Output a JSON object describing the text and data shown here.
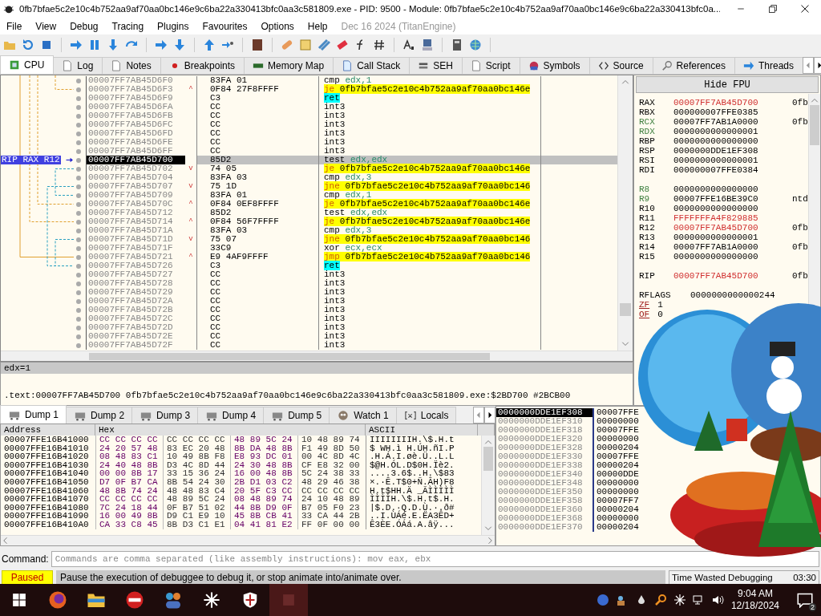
{
  "window": {
    "title": "0fb7bfae5c2e10c4b752aa9af70aa0bc146e9c6ba22a330413bfc0aa3c581809.exe - PID: 9500 - Module: 0fb7bfae5c2e10c4b752aa9af70aa0bc146e9c6ba22a330413bfc0a..."
  },
  "menu": [
    "File",
    "View",
    "Debug",
    "Tracing",
    "Plugins",
    "Favourites",
    "Options",
    "Help"
  ],
  "build_info": "Dec 16 2024 (TitanEngine)",
  "tabs": [
    {
      "label": "CPU",
      "selected": true
    },
    {
      "label": "Log",
      "selected": false
    },
    {
      "label": "Notes",
      "selected": false
    },
    {
      "label": "Breakpoints",
      "selected": false
    },
    {
      "label": "Memory Map",
      "selected": false
    },
    {
      "label": "Call Stack",
      "selected": false
    },
    {
      "label": "SEH",
      "selected": false
    },
    {
      "label": "Script",
      "selected": false
    },
    {
      "label": "Symbols",
      "selected": false
    },
    {
      "label": "Source",
      "selected": false
    },
    {
      "label": "References",
      "selected": false
    },
    {
      "label": "Threads",
      "selected": false
    }
  ],
  "disassembly": {
    "rip_label": "RIP RAX R12",
    "rows": [
      {
        "address": "00007FF7AB45D6F0",
        "bytes": "83FA 01",
        "kind": "plain",
        "mnemonic": "cmp",
        "operands": "edx,1",
        "selected": false
      },
      {
        "address": "00007FF7AB45D6F3",
        "jump": "^",
        "bytes": "0F84 27F8FFFF",
        "kind": "jump",
        "mnemonic": "je",
        "operands": "0fb7bfae5c2e10c4b752aa9af70aa0bc146e",
        "selected": false
      },
      {
        "address": "00007FF7AB45D6F9",
        "bytes": "C3",
        "kind": "ret",
        "mnemonic": "ret",
        "selected": false
      },
      {
        "address": "00007FF7AB45D6FA",
        "bytes": "CC",
        "kind": "plain",
        "mnemonic": "int3",
        "selected": false
      },
      {
        "address": "00007FF7AB45D6FB",
        "bytes": "CC",
        "kind": "plain",
        "mnemonic": "int3",
        "selected": false
      },
      {
        "address": "00007FF7AB45D6FC",
        "bytes": "CC",
        "kind": "plain",
        "mnemonic": "int3",
        "selected": false
      },
      {
        "address": "00007FF7AB45D6FD",
        "bytes": "CC",
        "kind": "plain",
        "mnemonic": "int3",
        "selected": false
      },
      {
        "address": "00007FF7AB45D6FE",
        "bytes": "CC",
        "kind": "plain",
        "mnemonic": "int3",
        "selected": false
      },
      {
        "address": "00007FF7AB45D6FF",
        "bytes": "CC",
        "kind": "plain",
        "mnemonic": "int3",
        "selected": false
      },
      {
        "address": "00007FF7AB45D700",
        "bytes": "85D2",
        "kind": "plain",
        "mnemonic": "test",
        "operands": "edx,edx",
        "selected": true
      },
      {
        "address": "00007FF7AB45D702",
        "jump": "v",
        "bytes": "74 05",
        "kind": "jump",
        "mnemonic": "je",
        "operands": "0fb7bfae5c2e10c4b752aa9af70aa0bc146e",
        "selected": false
      },
      {
        "address": "00007FF7AB45D704",
        "bytes": "83FA 03",
        "kind": "plain",
        "mnemonic": "cmp",
        "operands": "edx,3",
        "selected": false
      },
      {
        "address": "00007FF7AB45D707",
        "jump": "v",
        "bytes": "75 1D",
        "kind": "jump",
        "mnemonic": "jne",
        "operands": "0fb7bfae5c2e10c4b752aa9af70aa0bc146",
        "selected": false
      },
      {
        "address": "00007FF7AB45D709",
        "bytes": "83FA 01",
        "kind": "plain",
        "mnemonic": "cmp",
        "operands": "edx,1",
        "selected": false
      },
      {
        "address": "00007FF7AB45D70C",
        "jump": "^",
        "bytes": "0F84 0EF8FFFF",
        "kind": "jump",
        "mnemonic": "je",
        "operands": "0fb7bfae5c2e10c4b752aa9af70aa0bc146e",
        "selected": false
      },
      {
        "address": "00007FF7AB45D712",
        "bytes": "85D2",
        "kind": "plain",
        "mnemonic": "test",
        "operands": "edx,edx",
        "selected": false
      },
      {
        "address": "00007FF7AB45D714",
        "jump": "^",
        "bytes": "0F84 56F7FFFF",
        "kind": "jump",
        "mnemonic": "je",
        "operands": "0fb7bfae5c2e10c4b752aa9af70aa0bc146e",
        "selected": false
      },
      {
        "address": "00007FF7AB45D71A",
        "bytes": "83FA 03",
        "kind": "plain",
        "mnemonic": "cmp",
        "operands": "edx,3",
        "selected": false
      },
      {
        "address": "00007FF7AB45D71D",
        "jump": "v",
        "bytes": "75 07",
        "kind": "jump",
        "mnemonic": "jne",
        "operands": "0fb7bfae5c2e10c4b752aa9af70aa0bc146",
        "selected": false
      },
      {
        "address": "00007FF7AB45D71F",
        "bytes": "33C9",
        "kind": "plain",
        "mnemonic": "xor",
        "operands": "ecx,ecx",
        "selected": false
      },
      {
        "address": "00007FF7AB45D721",
        "jump": "^",
        "bytes": "E9 4AF9FFFF",
        "kind": "jump",
        "mnemonic": "jmp",
        "operands": "0fb7bfae5c2e10c4b752aa9af70aa0bc146",
        "selected": false
      },
      {
        "address": "00007FF7AB45D726",
        "bytes": "C3",
        "kind": "ret",
        "mnemonic": "ret",
        "selected": false
      },
      {
        "address": "00007FF7AB45D727",
        "bytes": "CC",
        "kind": "plain",
        "mnemonic": "int3",
        "selected": false
      },
      {
        "address": "00007FF7AB45D728",
        "bytes": "CC",
        "kind": "plain",
        "mnemonic": "int3",
        "selected": false
      },
      {
        "address": "00007FF7AB45D729",
        "bytes": "CC",
        "kind": "plain",
        "mnemonic": "int3",
        "selected": false
      },
      {
        "address": "00007FF7AB45D72A",
        "bytes": "CC",
        "kind": "plain",
        "mnemonic": "int3",
        "selected": false
      },
      {
        "address": "00007FF7AB45D72B",
        "bytes": "CC",
        "kind": "plain",
        "mnemonic": "int3",
        "selected": false
      },
      {
        "address": "00007FF7AB45D72C",
        "bytes": "CC",
        "kind": "plain",
        "mnemonic": "int3",
        "selected": false
      },
      {
        "address": "00007FF7AB45D72D",
        "bytes": "CC",
        "kind": "plain",
        "mnemonic": "int3",
        "selected": false
      },
      {
        "address": "00007FF7AB45D72E",
        "bytes": "CC",
        "kind": "plain",
        "mnemonic": "int3",
        "selected": false
      },
      {
        "address": "00007FF7AB45D72F",
        "bytes": "CC",
        "kind": "plain",
        "mnemonic": "int3",
        "selected": false
      }
    ]
  },
  "registers": {
    "button": "Hide FPU",
    "groups": [
      [
        {
          "name": "RAX",
          "value": "00007FF7AB45D700",
          "changed": true,
          "name_changed": false,
          "comment": "0fb"
        },
        {
          "name": "RBX",
          "value": "000000007FFE0385",
          "changed": false,
          "name_changed": false
        },
        {
          "name": "RCX",
          "value": "00007FF7AB1A0000",
          "changed": false,
          "name_changed": true,
          "comment": "0fb"
        },
        {
          "name": "RDX",
          "value": "0000000000000001",
          "changed": false,
          "name_changed": true
        },
        {
          "name": "RBP",
          "value": "0000000000000000",
          "changed": false,
          "name_changed": false
        },
        {
          "name": "RSP",
          "value": "0000000DDE1EF308",
          "changed": false,
          "name_changed": false
        },
        {
          "name": "RSI",
          "value": "0000000000000001",
          "changed": false,
          "name_changed": false
        },
        {
          "name": "RDI",
          "value": "000000007FFE0384",
          "changed": false,
          "name_changed": false
        }
      ],
      [
        {
          "name": "R8",
          "value": "0000000000000000",
          "changed": false,
          "name_changed": true
        },
        {
          "name": "R9",
          "value": "00007FFE16BE39C0",
          "changed": false,
          "name_changed": true,
          "comment": "ntd"
        },
        {
          "name": "R10",
          "value": "0000000000000000",
          "changed": false,
          "name_changed": false
        },
        {
          "name": "R11",
          "value": "FFFFFFFA4F829885",
          "changed": true,
          "name_changed": false
        },
        {
          "name": "R12",
          "value": "00007FF7AB45D700",
          "changed": true,
          "name_changed": false,
          "comment": "0fb"
        },
        {
          "name": "R13",
          "value": "0000000000000001",
          "changed": false,
          "name_changed": false
        },
        {
          "name": "R14",
          "value": "00007FF7AB1A0000",
          "changed": false,
          "name_changed": false,
          "comment": "0fb"
        },
        {
          "name": "R15",
          "value": "0000000000000000",
          "changed": false,
          "name_changed": false
        }
      ],
      [
        {
          "name": "RIP",
          "value": "00007FF7AB45D700",
          "changed": true,
          "name_changed": false,
          "comment": "0fb"
        }
      ]
    ],
    "rflags": {
      "name": "RFLAGS",
      "value": "0000000000000244"
    },
    "flags": [
      {
        "name": "ZF",
        "value": "1"
      },
      {
        "name": "OF",
        "value": "0"
      }
    ]
  },
  "info": {
    "line_1": "edx=1",
    "line_2": ".text:00007FF7AB45D700 0fb7bfae5c2e10c4b752aa9af70aa0bc146e9c6ba22a330413bfc0aa3c581809.exe:$2BD700 #2BCB00"
  },
  "dump_tabs": [
    {
      "label": "Dump 1",
      "selected": true
    },
    {
      "label": "Dump 2",
      "selected": false
    },
    {
      "label": "Dump 3",
      "selected": false
    },
    {
      "label": "Dump 4",
      "selected": false
    },
    {
      "label": "Dump 5",
      "selected": false
    },
    {
      "label": "Watch 1",
      "selected": false
    },
    {
      "label": "Locals",
      "selected": false
    }
  ],
  "dump": {
    "columns": [
      "Address",
      "Hex",
      "ASCII"
    ],
    "rows": [
      {
        "address": "00007FFE16B41000",
        "hex": [
          "CC CC CC CC",
          "CC CC CC CC",
          "48 89 5C 24",
          "10 48 89 74"
        ],
        "ascii": "ÌÌÌÌÌÌÌÌH.\\$.H.t"
      },
      {
        "address": "00007FFE16B41010",
        "hex": [
          "24 20 57 48",
          "83 EC 20 48",
          "8B DA 48 8B",
          "F1 49 8D 50"
        ],
        "ascii": "$ WH.ì H.ÚH.ñI.P"
      },
      {
        "address": "00007FFE16B41020",
        "hex": [
          "08 48 83 C1",
          "10 49 8B F8",
          "E8 93 DC 01",
          "00 4C 8D 4C"
        ],
        "ascii": ".H.Á.I.øè.Ü..L.L"
      },
      {
        "address": "00007FFE16B41030",
        "hex": [
          "24 40 48 8B",
          "D3 4C 8D 44",
          "24 30 48 8B",
          "CF E8 32 00"
        ],
        "ascii": "$@H.ÓL.D$0H.Ïè2."
      },
      {
        "address": "00007FFE16B41040",
        "hex": [
          "00 00 8B 17",
          "33 15 36 24",
          "16 00 48 8B",
          "5C 24 38 33"
        ],
        "ascii": "....3.6$..H.\\$83"
      },
      {
        "address": "00007FFE16B41050",
        "hex": [
          "D7 0F B7 CA",
          "8B 54 24 30",
          "2B D1 03 C2",
          "48 29 46 38"
        ],
        "ascii": "×.·Ê.T$0+Ñ.ÂH)F8"
      },
      {
        "address": "00007FFE16B41060",
        "hex": [
          "48 8B 74 24",
          "48 48 83 C4",
          "20 5F C3 CC",
          "CC CC CC CC"
        ],
        "ascii": "H.t$HH.Ä _ÃÌÌÌÌÌ"
      },
      {
        "address": "00007FFE16B41070",
        "hex": [
          "CC CC CC CC",
          "48 89 5C 24",
          "08 48 89 74",
          "24 10 48 89"
        ],
        "ascii": "ÌÌÌÌH.\\$.H.t$.H."
      },
      {
        "address": "00007FFE16B41080",
        "hex": [
          "7C 24 18 44",
          "0F B7 51 02",
          "44 8B D9 0F",
          "B7 05 F0 23"
        ],
        "ascii": "|$.D.·Q.D.Ù.·.ð#"
      },
      {
        "address": "00007FFE16B41090",
        "hex": [
          "16 00 49 8B",
          "D9 C1 E9 10",
          "45 8B CB 41",
          "33 CA 44 2B"
        ],
        "ascii": "..I.ÙÁé.E.ËA3ÊD+"
      },
      {
        "address": "00007FFE16B410A0",
        "hex": [
          "CA 33 C8 45",
          "8B D3 C1 E1",
          "04 41 81 E2",
          "FF 0F 00 00"
        ],
        "ascii": "Ê3ÈE.ÓÁá.A.âÿ..."
      }
    ]
  },
  "stack": {
    "rows": [
      {
        "address": "0000000DDE1EF308",
        "value": "00007FFE",
        "selected": true
      },
      {
        "address": "0000000DDE1EF310",
        "value": "00000000",
        "selected": false
      },
      {
        "address": "0000000DDE1EF318",
        "value": "00007FFE",
        "selected": false
      },
      {
        "address": "0000000DDE1EF320",
        "value": "00000000",
        "selected": false
      },
      {
        "address": "0000000DDE1EF328",
        "value": "00000204",
        "selected": false
      },
      {
        "address": "0000000DDE1EF330",
        "value": "00007FFE",
        "selected": false
      },
      {
        "address": "0000000DDE1EF338",
        "value": "00000204",
        "selected": false
      },
      {
        "address": "0000000DDE1EF340",
        "value": "00000DDE",
        "selected": false
      },
      {
        "address": "0000000DDE1EF348",
        "value": "00000000",
        "selected": false
      },
      {
        "address": "0000000DDE1EF350",
        "value": "00000000",
        "selected": false
      },
      {
        "address": "0000000DDE1EF358",
        "value": "00007FF7",
        "selected": false
      },
      {
        "address": "0000000DDE1EF360",
        "value": "00000204",
        "selected": false
      },
      {
        "address": "0000000DDE1EF368",
        "value": "00000000",
        "selected": false
      },
      {
        "address": "0000000DDE1EF370",
        "value": "00000204",
        "selected": false
      }
    ]
  },
  "command": {
    "label": "Command:",
    "placeholder": "Commands are comma separated (like assembly instructions): mov eax, ebx"
  },
  "status_bar": {
    "state": "Paused",
    "message": "Pause the execution of debuggee to debug it, or stop animate into/animate over.",
    "timer_label": "Time Wasted Debugging",
    "timer_value": "03:30"
  },
  "taskbar": {
    "time": "9:04 AM",
    "date": "12/18/2024",
    "notifications": "2"
  }
}
